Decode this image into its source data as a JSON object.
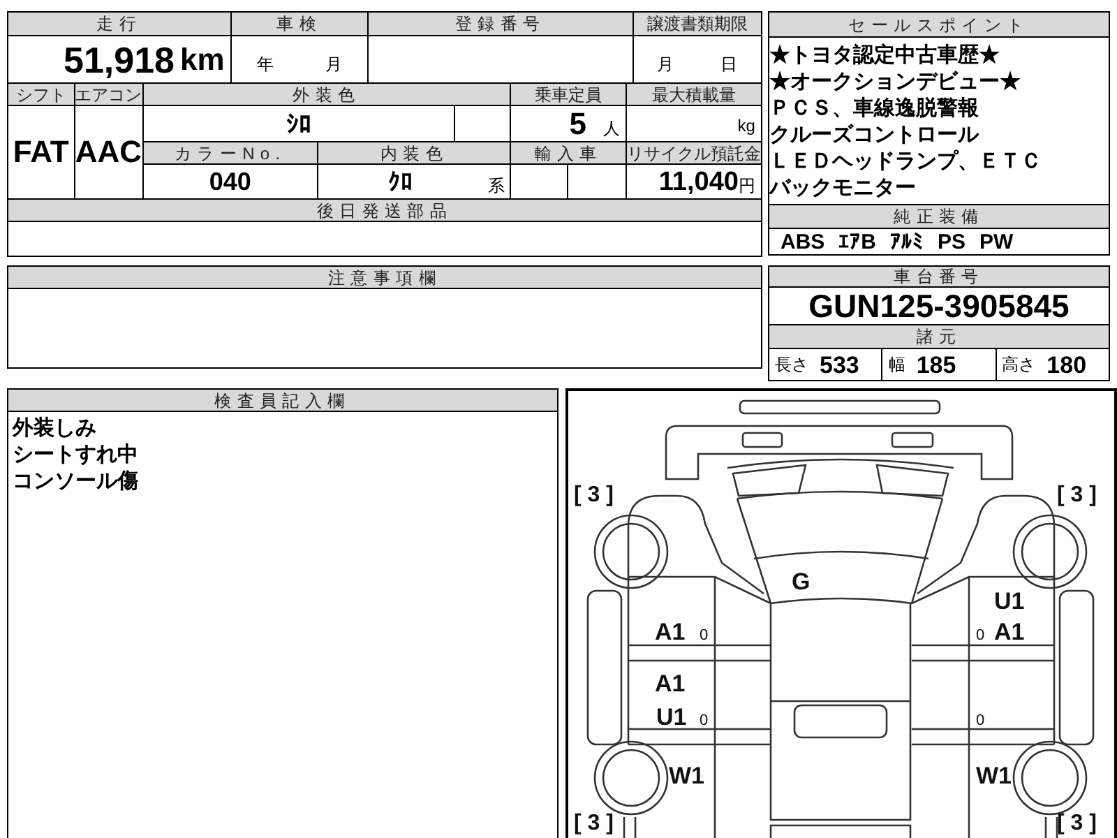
{
  "mileage": {
    "label": "走行",
    "value": "51,918",
    "unit": "km"
  },
  "inspection": {
    "label": "車検",
    "year_unit": "年",
    "month_unit": "月"
  },
  "registration": {
    "label": "登録番号"
  },
  "transfer_deadline": {
    "label": "譲渡書類期限",
    "month_unit": "月",
    "day_unit": "日"
  },
  "shift": {
    "label": "シフト",
    "value": "FAT"
  },
  "aircon": {
    "label": "エアコン",
    "value": "AAC"
  },
  "exterior_color": {
    "label": "外装色",
    "value": "ｼﾛ"
  },
  "capacity": {
    "label": "乗車定員",
    "value": "5",
    "unit": "人"
  },
  "max_load": {
    "label": "最大積載量",
    "unit": "kg"
  },
  "color_no": {
    "label": "カラーNo.",
    "value": "040"
  },
  "interior_color": {
    "label": "内装色",
    "value": "ｸﾛ",
    "suffix": "系"
  },
  "imported": {
    "label": "輸入車"
  },
  "recycle_fee": {
    "label": "リサイクル預託金",
    "value": "11,040",
    "unit": "円"
  },
  "later_parts": {
    "label": "後日発送部品"
  },
  "notes": {
    "label": "注意事項欄"
  },
  "inspector_notes": {
    "label": "検査員記入欄",
    "lines": [
      "外装しみ",
      "シートすれ中",
      "コンソール傷"
    ]
  },
  "sale_points": {
    "label": "セールスポイント",
    "lines": [
      "★トヨタ認定中古車歴★",
      "★オークションデビュー★",
      "ＰＣＳ、車線逸脱警報",
      "クルーズコントロール",
      "ＬＥＤヘッドランプ、ＥＴＣ",
      "バックモニター"
    ]
  },
  "equipment": {
    "label": "純正装備",
    "items": [
      "ABS",
      "ｴｱB",
      "ｱﾙﾐ",
      "PS",
      "PW"
    ]
  },
  "chassis": {
    "label": "車台番号",
    "value": "GUN125-3905845"
  },
  "specs": {
    "label": "諸元",
    "items": [
      {
        "label": "長さ",
        "value": "533"
      },
      {
        "label": "幅",
        "value": "185"
      },
      {
        "label": "高さ",
        "value": "180"
      }
    ]
  },
  "diagram": {
    "corner_ratings": [
      "[ 3 ]",
      "[ 3 ]",
      "[ 3 ]",
      "[ 3 ]"
    ],
    "marks": [
      {
        "kind": "code",
        "text": "G"
      },
      {
        "kind": "code",
        "text": "U1"
      },
      {
        "kind": "code",
        "text": "A1"
      },
      {
        "kind": "dent",
        "text": "0"
      },
      {
        "kind": "dent",
        "text": "0"
      },
      {
        "kind": "code",
        "text": "A1"
      },
      {
        "kind": "code",
        "text": "A1"
      },
      {
        "kind": "code",
        "text": "U1"
      },
      {
        "kind": "dent",
        "text": "0"
      },
      {
        "kind": "dent",
        "text": "0"
      },
      {
        "kind": "code",
        "text": "W1"
      },
      {
        "kind": "code",
        "text": "W1"
      }
    ]
  }
}
